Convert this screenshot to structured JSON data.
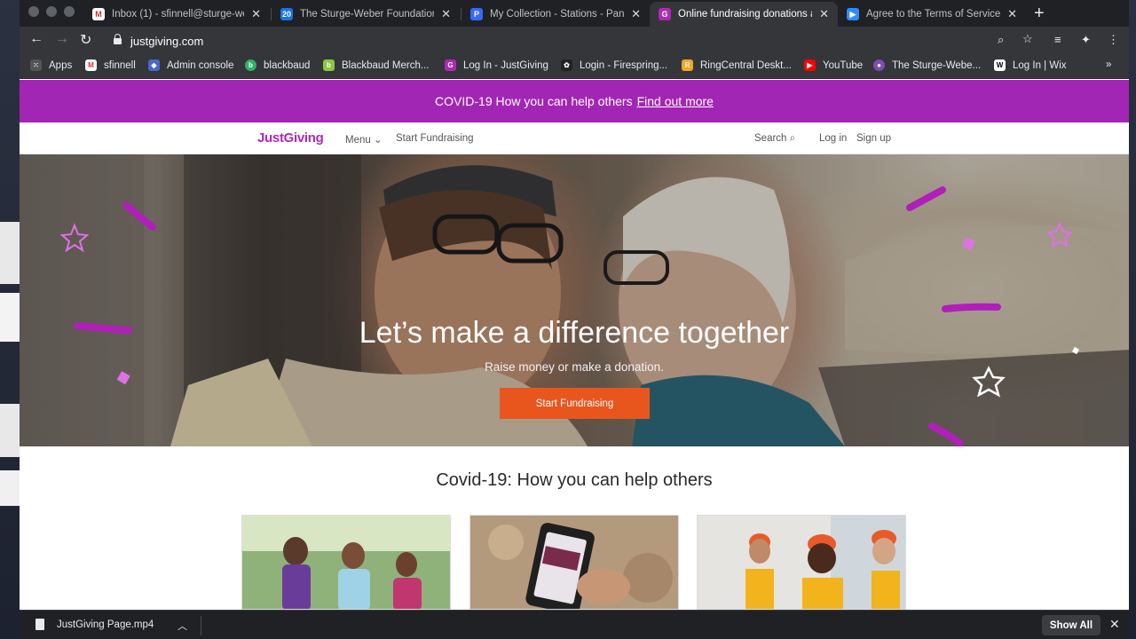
{
  "browser": {
    "tabs": [
      {
        "label": "Inbox (1) - sfinnell@sturge-we",
        "icon": "gmail-icon",
        "color": "#d93025"
      },
      {
        "label": "The Sturge-Weber Foundation",
        "icon": "calendar-icon",
        "color": "#1a73e8"
      },
      {
        "label": "My Collection - Stations - Pand",
        "icon": "pandora-icon",
        "color": "#3668ff"
      },
      {
        "label": "Online fundraising donations a",
        "icon": "justgiving-icon",
        "color": "#ad29b6"
      },
      {
        "label": "Agree to the Terms of Service",
        "icon": "zoom-icon",
        "color": "#2d8cff"
      }
    ],
    "active_tab": 3,
    "url": "justgiving.com",
    "bookmarks": [
      {
        "label": "Apps",
        "icon": "apps-grid-icon"
      },
      {
        "label": "sfinnell",
        "icon": "gmail-icon"
      },
      {
        "label": "Admin console",
        "icon": "admin-icon"
      },
      {
        "label": "blackbaud",
        "icon": "blackbaud-icon"
      },
      {
        "label": "Blackbaud Merch...",
        "icon": "blackbaud-merchant-icon"
      },
      {
        "label": "Log In - JustGiving",
        "icon": "justgiving-icon"
      },
      {
        "label": "Login - Firespring...",
        "icon": "firespring-icon"
      },
      {
        "label": "RingCentral Deskt...",
        "icon": "ringcentral-icon"
      },
      {
        "label": "YouTube",
        "icon": "youtube-icon"
      },
      {
        "label": "The Sturge-Webe...",
        "icon": "sturge-weber-icon"
      },
      {
        "label": "Log In | Wix",
        "icon": "wix-icon"
      }
    ]
  },
  "page": {
    "banner": {
      "text": "COVID-19 How you can help others",
      "link": "Find out more"
    },
    "nav": {
      "logo": "JustGiving",
      "menu": "Menu",
      "start": "Start Fundraising",
      "search": "Search",
      "login": "Log in",
      "signup": "Sign up"
    },
    "hero": {
      "title": "Let’s make a difference together",
      "subtitle": "Raise money or make a donation.",
      "cta": "Start Fundraising"
    },
    "section_title": "Covid-19: How you can help others",
    "colors": {
      "brand": "#ad29b6",
      "banner": "#a226b4",
      "cta": "#e8561e"
    }
  },
  "downloads": {
    "file": "JustGiving Page.mp4",
    "show_all": "Show All"
  }
}
